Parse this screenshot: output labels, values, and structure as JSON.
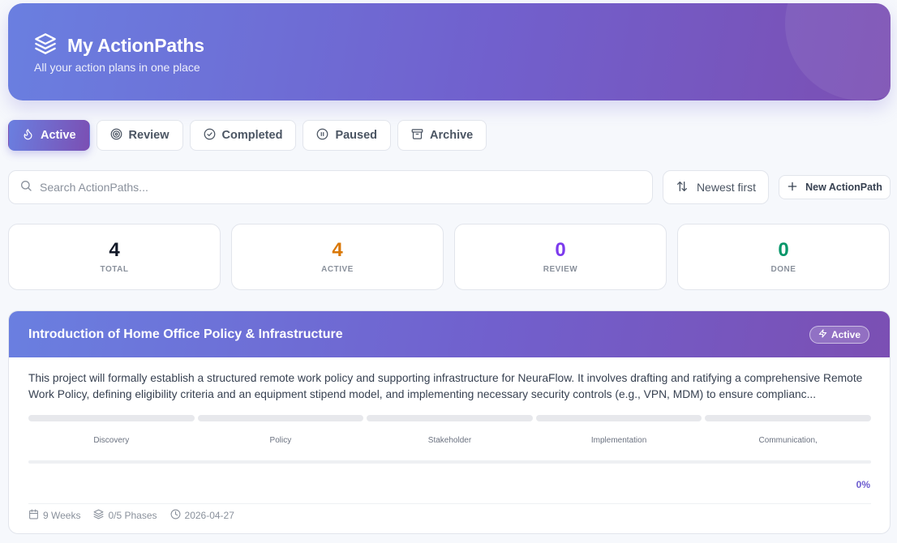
{
  "header": {
    "title": "My ActionPaths",
    "subtitle": "All your action plans in one place",
    "icon": "layers-icon"
  },
  "tabs": [
    {
      "label": "Active",
      "icon": "flame-icon",
      "active": true
    },
    {
      "label": "Review",
      "icon": "target-icon",
      "active": false
    },
    {
      "label": "Completed",
      "icon": "check-circle-icon",
      "active": false
    },
    {
      "label": "Paused",
      "icon": "pause-circle-icon",
      "active": false
    },
    {
      "label": "Archive",
      "icon": "archive-icon",
      "active": false
    }
  ],
  "search": {
    "placeholder": "Search ActionPaths..."
  },
  "sort": {
    "label": "Newest first"
  },
  "new_button": {
    "label": "New ActionPath"
  },
  "stats": [
    {
      "value": "4",
      "label": "TOTAL",
      "color": "#111827"
    },
    {
      "value": "4",
      "label": "ACTIVE",
      "color": "#d97706"
    },
    {
      "value": "0",
      "label": "REVIEW",
      "color": "#7c3aed"
    },
    {
      "value": "0",
      "label": "DONE",
      "color": "#059669"
    }
  ],
  "cards": [
    {
      "title": "Introduction of Home Office Policy & Infrastructure",
      "status": "Active",
      "description": "This project will formally establish a structured remote work policy and supporting infrastructure for NeuraFlow. It involves drafting and ratifying a comprehensive Remote Work Policy, defining eligibility criteria and an equipment stipend model, and implementing necessary security controls (e.g., VPN, MDM) to ensure complianc...",
      "phases": [
        "Discovery",
        "Policy",
        "Stakeholder",
        "Implementation",
        "Communication,"
      ],
      "progress_percent": 0,
      "progress_label": "0%",
      "duration": "9 Weeks",
      "phases_done": "0/5 Phases",
      "date": "2026-04-27"
    }
  ]
}
